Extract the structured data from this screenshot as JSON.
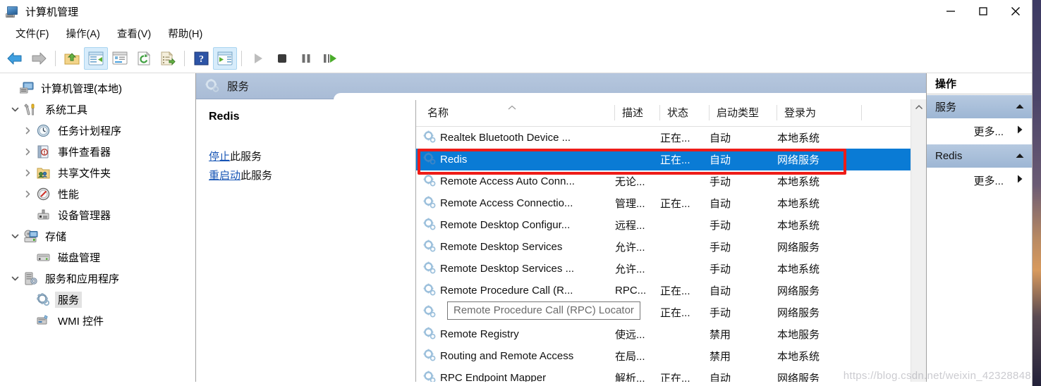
{
  "window": {
    "title": "计算机管理",
    "app_icon": "computer-management-icon",
    "buttons": {
      "minimize": "—",
      "maximize": "□",
      "close": "✕"
    }
  },
  "menubar": [
    {
      "label": "文件(F)",
      "mnemonic": "F"
    },
    {
      "label": "操作(A)",
      "mnemonic": "A"
    },
    {
      "label": "查看(V)",
      "mnemonic": "V"
    },
    {
      "label": "帮助(H)",
      "mnemonic": "H"
    }
  ],
  "toolbar": [
    {
      "name": "back-arrow-icon",
      "checked": false
    },
    {
      "name": "forward-arrow-icon",
      "checked": false
    },
    {
      "name": "separator",
      "checked": false
    },
    {
      "name": "up-folder-icon",
      "checked": false
    },
    {
      "name": "show-hide-tree-icon",
      "checked": true
    },
    {
      "name": "properties-icon",
      "checked": false
    },
    {
      "name": "refresh-icon",
      "checked": false
    },
    {
      "name": "export-list-icon",
      "checked": false
    },
    {
      "name": "separator",
      "checked": false
    },
    {
      "name": "help-icon",
      "checked": false
    },
    {
      "name": "show-action-pane-icon",
      "checked": true
    },
    {
      "name": "separator",
      "checked": false
    },
    {
      "name": "start-service-icon",
      "checked": false
    },
    {
      "name": "stop-service-icon",
      "checked": false
    },
    {
      "name": "pause-service-icon",
      "checked": false
    },
    {
      "name": "restart-service-icon",
      "checked": false
    }
  ],
  "tree": [
    {
      "label": "计算机管理(本地)",
      "indent": 0,
      "twisty": "none",
      "icon": "computer-icon",
      "selected": false
    },
    {
      "label": "系统工具",
      "indent": 1,
      "twisty": "expanded",
      "icon": "system-tools-icon",
      "selected": false
    },
    {
      "label": "任务计划程序",
      "indent": 2,
      "twisty": "collapsed",
      "icon": "task-scheduler-icon",
      "selected": false
    },
    {
      "label": "事件查看器",
      "indent": 2,
      "twisty": "collapsed",
      "icon": "event-viewer-icon",
      "selected": false
    },
    {
      "label": "共享文件夹",
      "indent": 2,
      "twisty": "collapsed",
      "icon": "shared-folders-icon",
      "selected": false
    },
    {
      "label": "性能",
      "indent": 2,
      "twisty": "collapsed",
      "icon": "performance-icon",
      "selected": false
    },
    {
      "label": "设备管理器",
      "indent": 2,
      "twisty": "none",
      "icon": "device-manager-icon",
      "selected": false
    },
    {
      "label": "存储",
      "indent": 1,
      "twisty": "expanded",
      "icon": "storage-icon",
      "selected": false
    },
    {
      "label": "磁盘管理",
      "indent": 2,
      "twisty": "none",
      "icon": "disk-management-icon",
      "selected": false
    },
    {
      "label": "服务和应用程序",
      "indent": 1,
      "twisty": "expanded",
      "icon": "services-apps-icon",
      "selected": false
    },
    {
      "label": "服务",
      "indent": 2,
      "twisty": "none",
      "icon": "services-icon",
      "selected": true
    },
    {
      "label": "WMI 控件",
      "indent": 2,
      "twisty": "none",
      "icon": "wmi-control-icon",
      "selected": false
    }
  ],
  "pane_header": {
    "icon": "services-icon",
    "title": "服务"
  },
  "detail": {
    "service_name": "Redis",
    "links": [
      {
        "link_text": "停止",
        "suffix": "此服务"
      },
      {
        "link_text": "重启动",
        "suffix": "此服务"
      }
    ]
  },
  "list": {
    "columns": [
      {
        "key": "name",
        "label": "名称",
        "sorted": "asc"
      },
      {
        "key": "desc",
        "label": "描述",
        "sorted": ""
      },
      {
        "key": "state",
        "label": "状态",
        "sorted": ""
      },
      {
        "key": "start",
        "label": "启动类型",
        "sorted": ""
      },
      {
        "key": "logon",
        "label": "登录为",
        "sorted": ""
      }
    ],
    "rows": [
      {
        "name": "Realtek Bluetooth Device ...",
        "desc": "",
        "state": "正在...",
        "start": "自动",
        "logon": "本地系统",
        "selected": false
      },
      {
        "name": "Redis",
        "desc": "",
        "state": "正在...",
        "start": "自动",
        "logon": "网络服务",
        "selected": true
      },
      {
        "name": "Remote Access Auto Conn...",
        "desc": "无论...",
        "state": "",
        "start": "手动",
        "logon": "本地系统",
        "selected": false
      },
      {
        "name": "Remote Access Connectio...",
        "desc": "管理...",
        "state": "正在...",
        "start": "自动",
        "logon": "本地系统",
        "selected": false
      },
      {
        "name": "Remote Desktop Configur...",
        "desc": "远程...",
        "state": "",
        "start": "手动",
        "logon": "本地系统",
        "selected": false
      },
      {
        "name": "Remote Desktop Services",
        "desc": "允许...",
        "state": "",
        "start": "手动",
        "logon": "网络服务",
        "selected": false
      },
      {
        "name": "Remote Desktop Services ...",
        "desc": "允许...",
        "state": "",
        "start": "手动",
        "logon": "本地系统",
        "selected": false
      },
      {
        "name": "Remote Procedure Call (R...",
        "desc": "RPC...",
        "state": "正在...",
        "start": "自动",
        "logon": "网络服务",
        "selected": false
      },
      {
        "name": "",
        "desc": "",
        "state": "正在...",
        "start": "手动",
        "logon": "网络服务",
        "selected": false
      },
      {
        "name": "Remote Registry",
        "desc": "使远...",
        "state": "",
        "start": "禁用",
        "logon": "本地服务",
        "selected": false
      },
      {
        "name": "Routing and Remote Access",
        "desc": "在局...",
        "state": "",
        "start": "禁用",
        "logon": "本地系统",
        "selected": false
      },
      {
        "name": "RPC Endpoint Mapper",
        "desc": "解析...",
        "state": "正在...",
        "start": "自动",
        "logon": "网络服务",
        "selected": false
      }
    ],
    "tooltip": "Remote Procedure Call (RPC) Locator",
    "highlight_row_index": 1
  },
  "actions": {
    "title": "操作",
    "groups": [
      {
        "header": "服务",
        "items": [
          {
            "label": "更多...",
            "submenu": true
          }
        ]
      },
      {
        "header": "Redis",
        "items": [
          {
            "label": "更多...",
            "submenu": true
          }
        ]
      }
    ]
  },
  "watermark": "https://blog.csdn.net/weixin_42328848",
  "colors": {
    "selection_blue": "#0a7bd5",
    "annotation_red": "#ee1c18",
    "header_blue": "#a9bcd6",
    "link_blue": "#1755b5"
  }
}
